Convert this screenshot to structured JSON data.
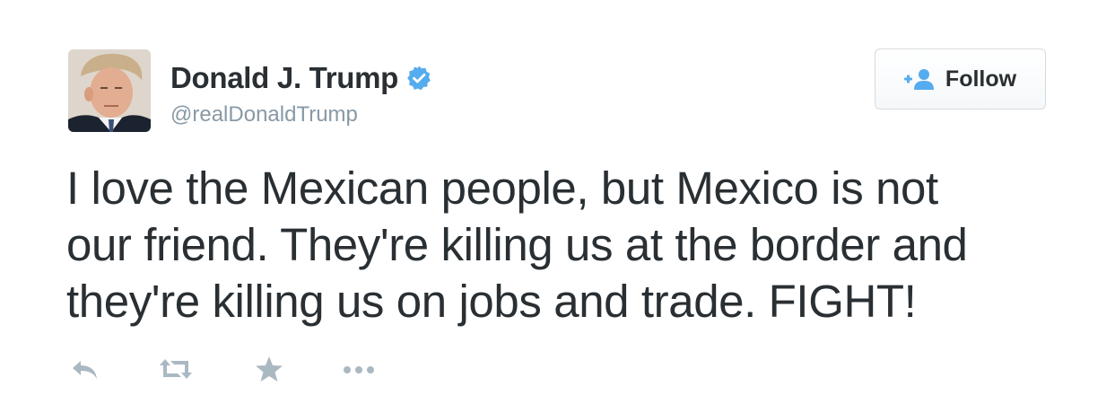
{
  "author": {
    "display_name": "Donald J. Trump",
    "handle": "@realDonaldTrump",
    "verified": true
  },
  "follow_button": {
    "label": "Follow"
  },
  "tweet": {
    "lines": [
      "I love the Mexican people, but Mexico is not",
      "our friend. They're killing us at the border and",
      "they're killing us on jobs and trade. FIGHT!"
    ]
  },
  "actions": {
    "icons": [
      "reply-icon",
      "retweet-icon",
      "favorite-icon",
      "more-icon"
    ]
  },
  "colors": {
    "text": "#292f33",
    "secondary": "#8899a6",
    "accent": "#55acee",
    "action_icons": "#aab8c2"
  }
}
